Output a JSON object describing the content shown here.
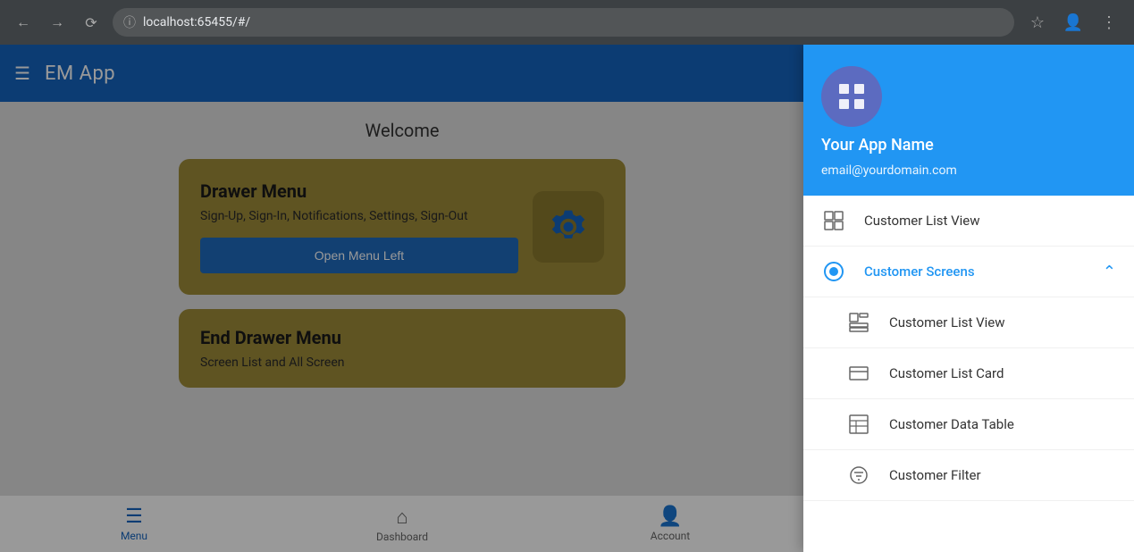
{
  "browser": {
    "url": "localhost:65455/#/",
    "back_title": "back",
    "forward_title": "forward",
    "refresh_title": "refresh"
  },
  "app": {
    "title": "EM App",
    "header_bg": "#1565c0"
  },
  "welcome": {
    "title": "Welcome"
  },
  "drawer_menu_card": {
    "title": "Drawer Menu",
    "subtitle": "Sign-Up, Sign-In, Notifications, Settings, Sign-Out",
    "button_label": "Open Menu Left"
  },
  "end_drawer_card": {
    "title": "End Drawer Menu",
    "subtitle": "Screen List and All Screen"
  },
  "bottom_nav": {
    "items": [
      {
        "label": "Menu",
        "active": true
      },
      {
        "label": "Dashboard",
        "active": false
      },
      {
        "label": "Account",
        "active": false
      }
    ]
  },
  "drawer": {
    "app_name": "Your App Name",
    "email": "email@yourdomain.com",
    "avatar_icon": "grid-icon",
    "items": [
      {
        "label": "Customer List View",
        "icon": "table-icon",
        "active": false,
        "has_submenu": false
      },
      {
        "label": "Customer Screens",
        "icon": "radio-circle-icon",
        "active": true,
        "has_submenu": true,
        "expanded": true
      }
    ],
    "sub_items": [
      {
        "label": "Customer List View",
        "icon": "list-icon"
      },
      {
        "label": "Customer List Card",
        "icon": "card-icon"
      },
      {
        "label": "Customer Data Table",
        "icon": "data-table-icon"
      },
      {
        "label": "Customer Filter",
        "icon": "filter-icon"
      }
    ]
  }
}
